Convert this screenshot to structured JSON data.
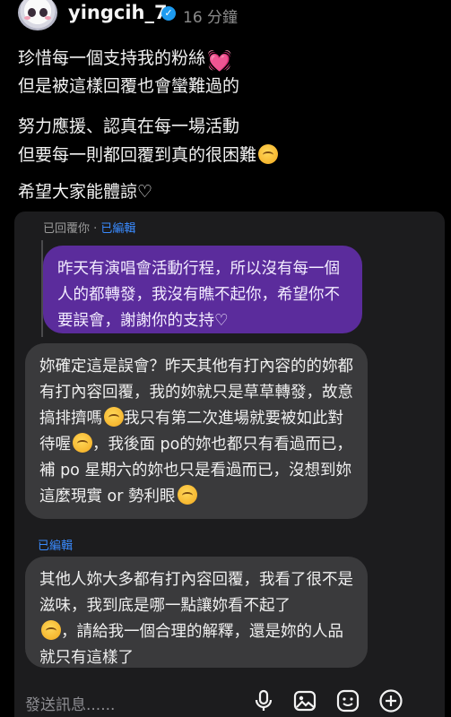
{
  "header": {
    "username": "yingcih_7",
    "verified_icon": "verified-badge-icon",
    "time": "16 分鐘"
  },
  "post": {
    "line1": "珍惜每一個支持我的粉絲",
    "line2": "但是被這樣回覆也會蠻難過的",
    "line3": "努力應援、認真在每一場活動",
    "line4": "但要每一則都回覆到真的很困難",
    "line5": "希望大家能體諒♡"
  },
  "thread": {
    "replied_prefix": "已回覆你",
    "separator": " · ",
    "edited_label": "已編輯",
    "quoted_message": "昨天有演唱會活動行程，所以沒有每一個人的都轉發，我沒有瞧不起你，希望你不要誤會，謝謝你的支持♡",
    "reply1_part1": "妳確定這是誤會？昨天其他有打內容的的妳都有打內容回覆，我的妳就只是草草轉發，故意搞排擠嗎",
    "reply1_part2": "我只有第二次進場就要被如此對待喔",
    "reply1_part3": "，我後面 po的妳也都只有看過而已，補 po 星期六的妳也只是看過而已，沒想到妳這麼現實 or 勢利眼",
    "edited_label_2": "已編輯",
    "reply2_part1": "其他人妳大多都有打內容回覆，我看了很不是滋味，我到底是哪一點讓妳看不起了",
    "reply2_part2": "，請給我一個合理的解釋，還是妳的人品就只有這樣了"
  },
  "composer": {
    "placeholder": "發送訊息......",
    "icons": [
      "microphone-icon",
      "image-icon",
      "sticker-icon",
      "add-icon"
    ]
  }
}
